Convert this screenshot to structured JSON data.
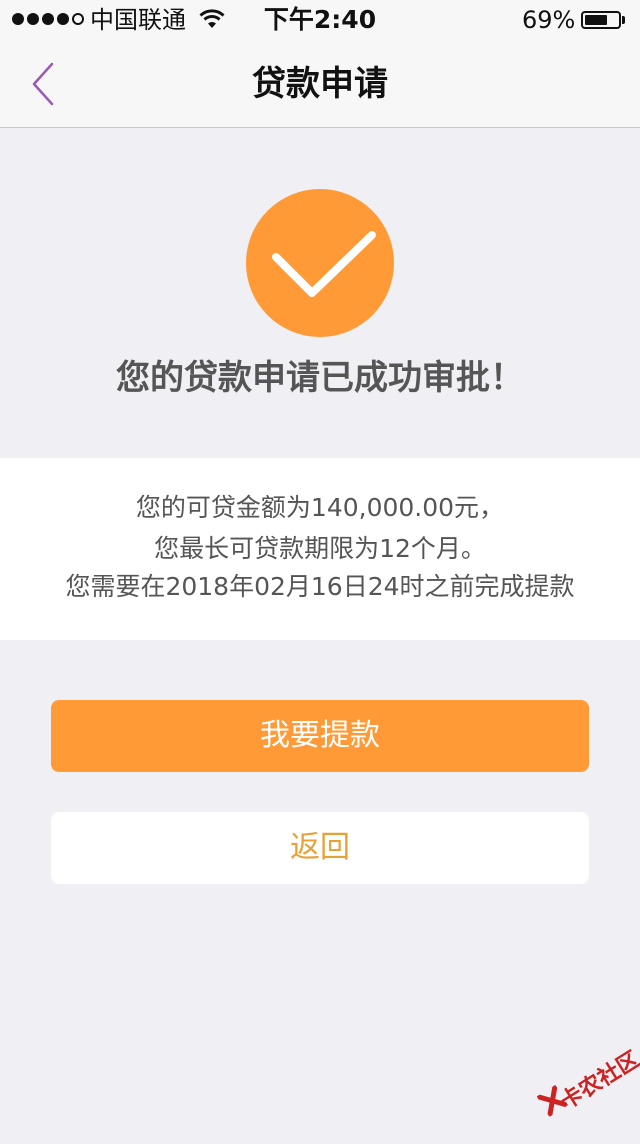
{
  "status_bar": {
    "carrier": "中国联通",
    "time": "下午2:40",
    "battery_percent": "69%",
    "battery_level": 0.69
  },
  "nav": {
    "title": "贷款申请",
    "back_icon": "chevron-left-icon"
  },
  "success": {
    "icon": "check-icon",
    "message": "您的贷款申请已成功审批！"
  },
  "info": {
    "line1": "您的可贷金额为140,000.00元，",
    "line2": "您最长可贷款期限为12个月。",
    "line3": "您需要在2018年02月16日24时之前完成提款"
  },
  "buttons": {
    "withdraw_label": "我要提款",
    "back_label": "返回"
  },
  "watermark": {
    "text": "卡农社区"
  },
  "colors": {
    "accent": "#ff9a36",
    "back_chevron": "#9b59b6",
    "secondary_text": "#e8a136",
    "background": "#efeff4"
  }
}
